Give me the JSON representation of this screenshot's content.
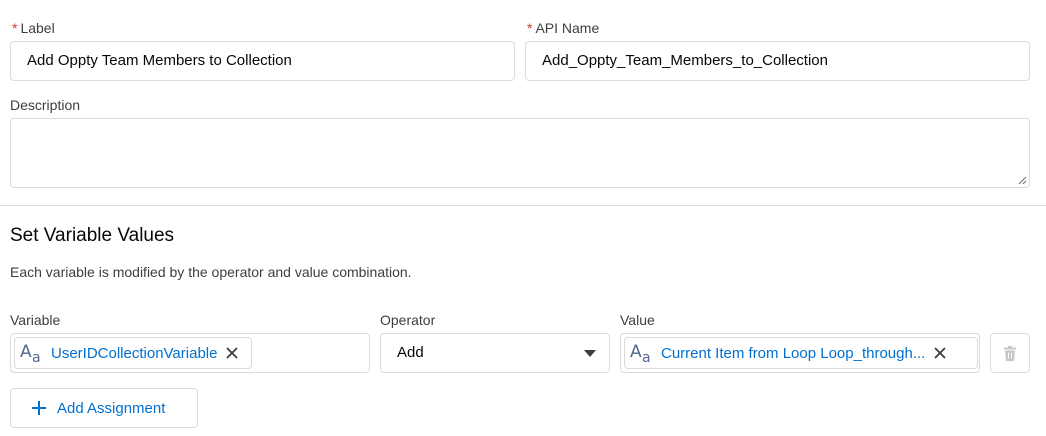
{
  "form": {
    "label": {
      "required_mark": "*",
      "text": "Label",
      "value": "Add Oppty Team Members to Collection"
    },
    "api_name": {
      "required_mark": "*",
      "text": "API Name",
      "value": "Add_Oppty_Team_Members_to_Collection"
    },
    "description": {
      "text": "Description",
      "value": ""
    }
  },
  "section": {
    "title": "Set Variable Values",
    "description": "Each variable is modified by the operator and value combination."
  },
  "assignment": {
    "variable_label": "Variable",
    "operator_label": "Operator",
    "value_label": "Value",
    "variable_pill": "UserIDCollectionVariable",
    "operator_value": "Add",
    "value_pill": "Current Item from Loop Loop_through..."
  },
  "actions": {
    "add_assignment": "Add Assignment"
  },
  "icons": {
    "text_type": "text-type-icon",
    "clear": "close-icon",
    "dropdown": "chevron-down-icon",
    "delete": "trash-icon",
    "add": "plus-icon",
    "resize": "resize-grip-icon"
  },
  "colors": {
    "link": "#0070d2",
    "required": "#c23934",
    "border": "#dddbda",
    "text": "#080707"
  }
}
